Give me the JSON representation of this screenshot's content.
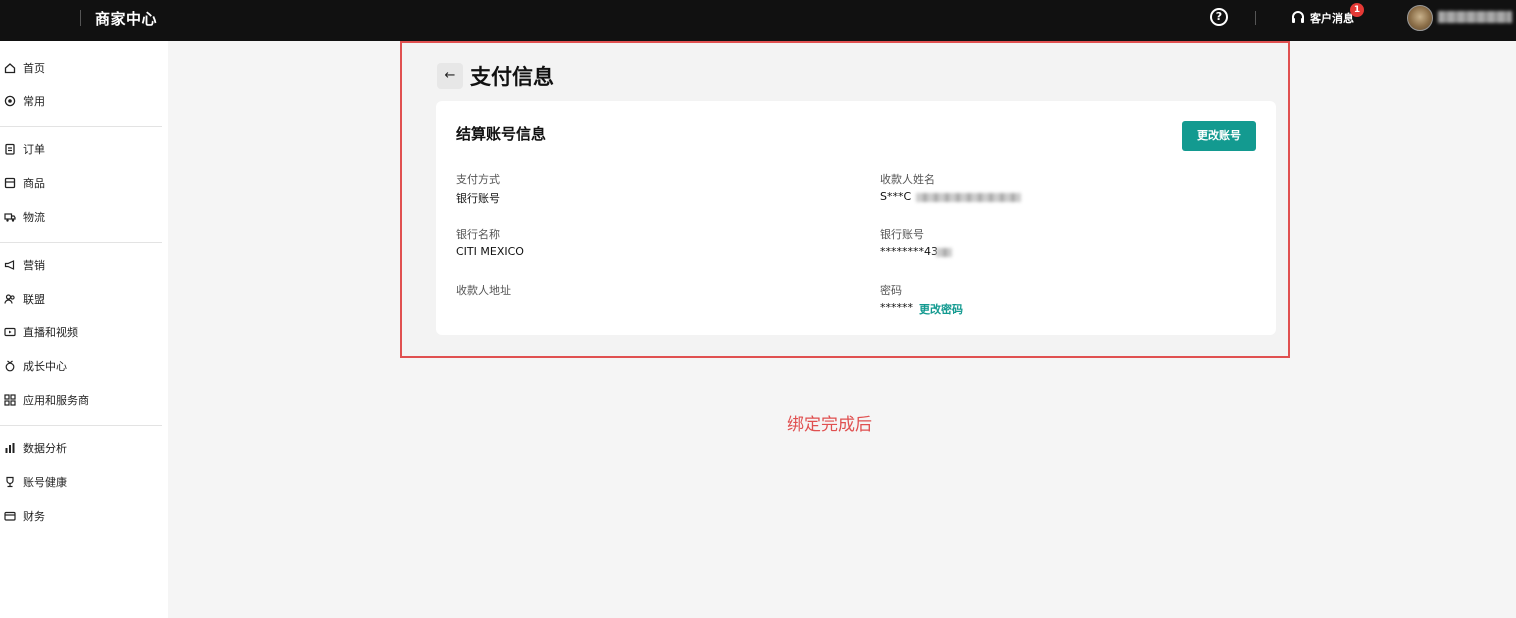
{
  "header": {
    "title": "商家中心",
    "help_glyph": "?",
    "support_label": "客户消息",
    "support_badge": "1"
  },
  "sidebar": {
    "items": [
      {
        "label": "首页",
        "icon": "home-icon"
      },
      {
        "label": "常用",
        "icon": "target-icon"
      },
      {
        "label": "订单",
        "icon": "clipboard-icon"
      },
      {
        "label": "商品",
        "icon": "box-icon"
      },
      {
        "label": "物流",
        "icon": "truck-icon"
      },
      {
        "label": "营销",
        "icon": "megaphone-icon"
      },
      {
        "label": "联盟",
        "icon": "users-icon"
      },
      {
        "label": "直播和视频",
        "icon": "video-icon"
      },
      {
        "label": "成长中心",
        "icon": "medal-icon"
      },
      {
        "label": "应用和服务商",
        "icon": "grid-icon"
      },
      {
        "label": "数据分析",
        "icon": "bar-chart-icon"
      },
      {
        "label": "账号健康",
        "icon": "trophy-icon"
      },
      {
        "label": "财务",
        "icon": "wallet-icon"
      }
    ]
  },
  "page": {
    "back_glyph": "←",
    "title": "支付信息"
  },
  "card": {
    "title": "结算账号信息",
    "change_account_label": "更改账号",
    "fields": {
      "payment_method": {
        "label": "支付方式",
        "value": "银行账号"
      },
      "payee_name": {
        "label": "收款人姓名",
        "value": "S***C"
      },
      "bank_name": {
        "label": "银行名称",
        "value": "CITI MEXICO"
      },
      "bank_account": {
        "label": "银行账号",
        "value": "********43"
      },
      "payee_address": {
        "label": "收款人地址",
        "value": ""
      },
      "password": {
        "label": "密码",
        "value": "******",
        "change_label": "更改密码"
      }
    }
  },
  "caption": "绑定完成后",
  "colors": {
    "accent": "#139a90",
    "highlight_border": "#e05050",
    "topbar": "#111111",
    "badge": "#e53935"
  }
}
